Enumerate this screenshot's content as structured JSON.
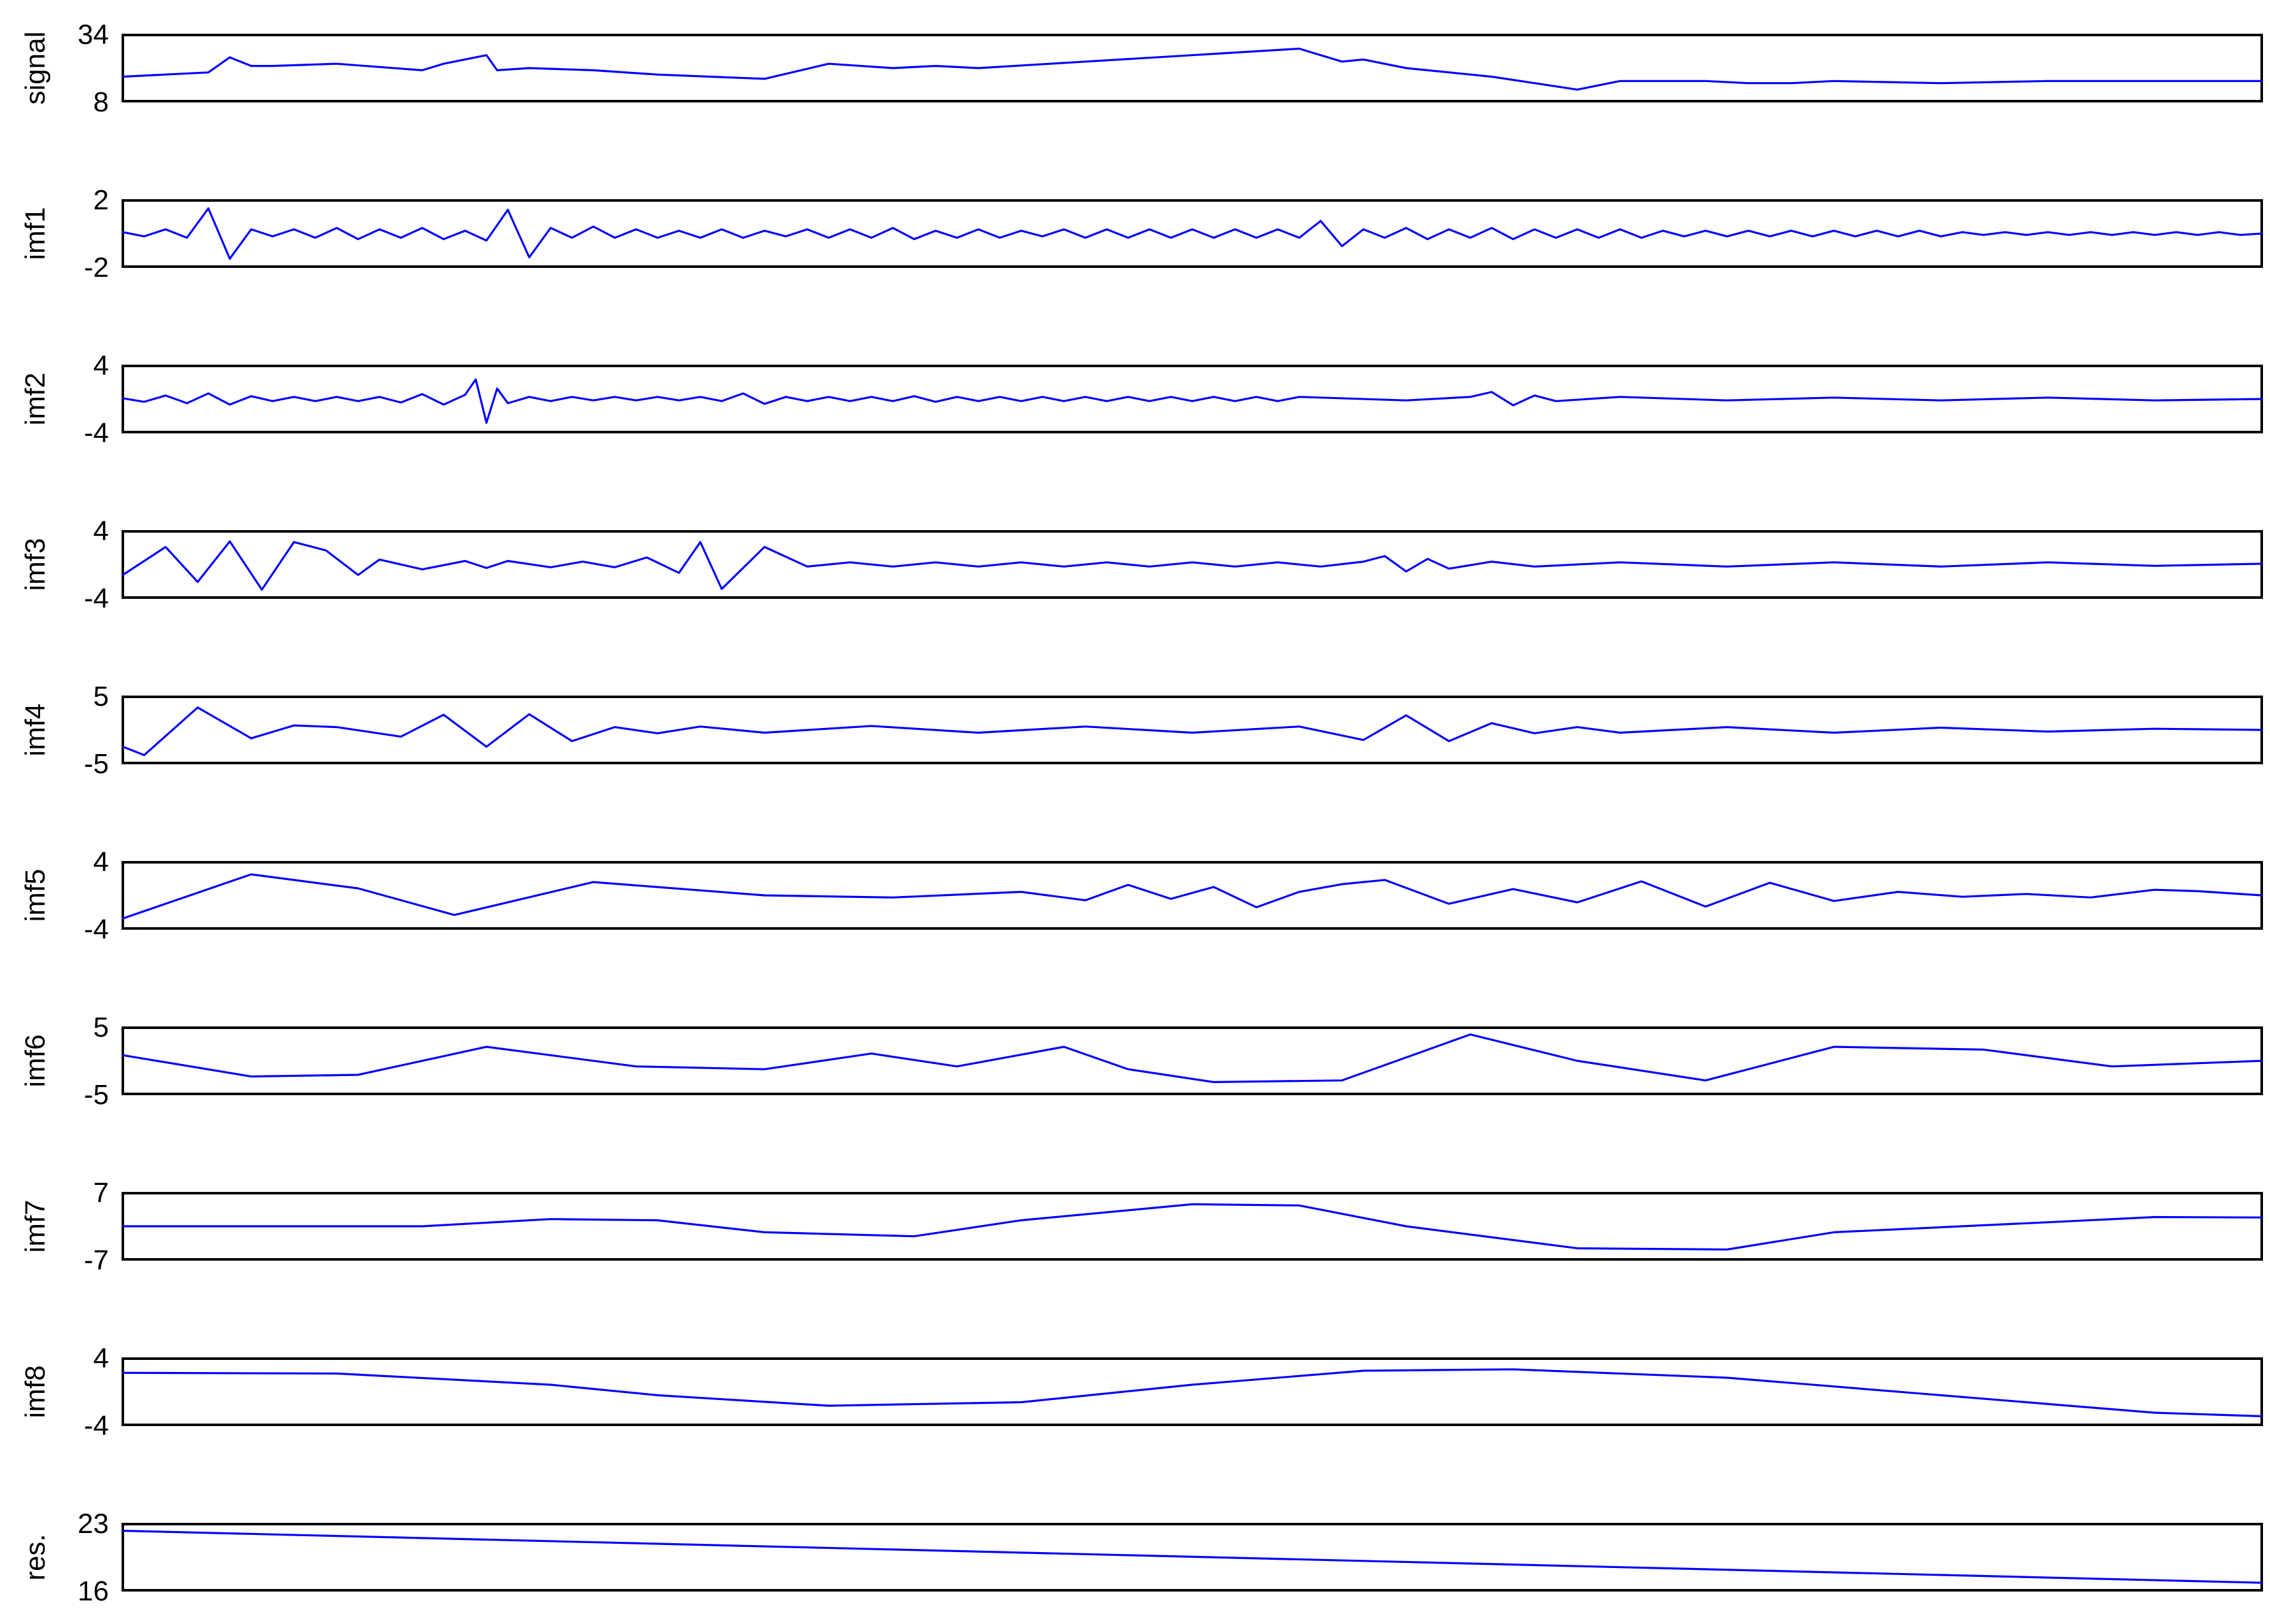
{
  "colors": {
    "trace": "#0000ff",
    "axes": "#000000",
    "background": "#ffffff"
  },
  "chart_data": [
    {
      "type": "line",
      "ylabel": "signal",
      "ylim": [
        8,
        34
      ],
      "yticks": [
        "34",
        "8"
      ],
      "grid": false,
      "legend": "none",
      "x": [
        0,
        0.04,
        0.05,
        0.06,
        0.07,
        0.1,
        0.14,
        0.15,
        0.17,
        0.175,
        0.19,
        0.22,
        0.25,
        0.3,
        0.33,
        0.36,
        0.38,
        0.4,
        0.45,
        0.5,
        0.55,
        0.57,
        0.58,
        0.6,
        0.64,
        0.68,
        0.7,
        0.72,
        0.74,
        0.76,
        0.78,
        0.8,
        0.85,
        0.9,
        0.95,
        1.0
      ],
      "y": [
        17,
        19,
        26,
        22,
        22,
        23,
        20,
        23,
        27,
        20,
        21,
        20,
        18,
        16,
        23,
        21,
        22,
        21,
        24,
        27,
        30,
        24,
        25,
        21,
        17,
        11,
        15,
        15,
        15,
        14,
        14,
        15,
        14,
        15,
        15,
        15
      ]
    },
    {
      "type": "line",
      "ylabel": "imf1",
      "ylim": [
        -2,
        2
      ],
      "yticks": [
        "2",
        "-2"
      ],
      "grid": false,
      "legend": "none",
      "x": [
        0,
        0.01,
        0.02,
        0.03,
        0.04,
        0.05,
        0.06,
        0.07,
        0.08,
        0.09,
        0.1,
        0.11,
        0.12,
        0.13,
        0.14,
        0.15,
        0.16,
        0.17,
        0.18,
        0.19,
        0.2,
        0.21,
        0.22,
        0.23,
        0.24,
        0.25,
        0.26,
        0.27,
        0.28,
        0.29,
        0.3,
        0.31,
        0.32,
        0.33,
        0.34,
        0.35,
        0.36,
        0.37,
        0.38,
        0.39,
        0.4,
        0.41,
        0.42,
        0.43,
        0.44,
        0.45,
        0.46,
        0.47,
        0.48,
        0.49,
        0.5,
        0.51,
        0.52,
        0.53,
        0.54,
        0.55,
        0.56,
        0.57,
        0.58,
        0.59,
        0.6,
        0.61,
        0.62,
        0.63,
        0.64,
        0.65,
        0.66,
        0.67,
        0.68,
        0.69,
        0.7,
        0.71,
        0.72,
        0.73,
        0.74,
        0.75,
        0.76,
        0.77,
        0.78,
        0.79,
        0.8,
        0.81,
        0.82,
        0.83,
        0.84,
        0.85,
        0.86,
        0.87,
        0.88,
        0.89,
        0.9,
        0.91,
        0.92,
        0.93,
        0.94,
        0.95,
        0.96,
        0.97,
        0.98,
        0.99,
        1.0
      ],
      "y": [
        0.1,
        -0.2,
        0.3,
        -0.3,
        1.8,
        -1.8,
        0.3,
        -0.2,
        0.3,
        -0.3,
        0.4,
        -0.4,
        0.3,
        -0.3,
        0.4,
        -0.4,
        0.2,
        -0.5,
        1.7,
        -1.7,
        0.4,
        -0.3,
        0.5,
        -0.3,
        0.3,
        -0.3,
        0.2,
        -0.3,
        0.3,
        -0.3,
        0.2,
        -0.2,
        0.3,
        -0.3,
        0.3,
        -0.3,
        0.4,
        -0.4,
        0.2,
        -0.3,
        0.3,
        -0.3,
        0.2,
        -0.2,
        0.3,
        -0.3,
        0.3,
        -0.3,
        0.3,
        -0.3,
        0.3,
        -0.3,
        0.3,
        -0.3,
        0.3,
        -0.3,
        0.9,
        -0.9,
        0.3,
        -0.3,
        0.4,
        -0.4,
        0.3,
        -0.3,
        0.4,
        -0.4,
        0.3,
        -0.3,
        0.3,
        -0.3,
        0.3,
        -0.3,
        0.2,
        -0.2,
        0.2,
        -0.2,
        0.2,
        -0.2,
        0.2,
        -0.2,
        0.2,
        -0.2,
        0.2,
        -0.2,
        0.2,
        -0.2,
        0.1,
        -0.1,
        0.1,
        -0.1,
        0.1,
        -0.1,
        0.1,
        -0.1,
        0.1,
        -0.1,
        0.1,
        -0.1,
        0.1,
        -0.1,
        0
      ]
    },
    {
      "type": "line",
      "ylabel": "imf2",
      "ylim": [
        -4,
        4
      ],
      "yticks": [
        "4",
        "-4"
      ],
      "grid": false,
      "legend": "none",
      "x": [
        0,
        0.01,
        0.02,
        0.03,
        0.04,
        0.05,
        0.06,
        0.07,
        0.08,
        0.09,
        0.1,
        0.11,
        0.12,
        0.13,
        0.14,
        0.15,
        0.16,
        0.165,
        0.17,
        0.175,
        0.18,
        0.19,
        0.2,
        0.21,
        0.22,
        0.23,
        0.24,
        0.25,
        0.26,
        0.27,
        0.28,
        0.29,
        0.3,
        0.31,
        0.32,
        0.33,
        0.34,
        0.35,
        0.36,
        0.37,
        0.38,
        0.39,
        0.4,
        0.41,
        0.42,
        0.43,
        0.44,
        0.45,
        0.46,
        0.47,
        0.48,
        0.49,
        0.5,
        0.51,
        0.52,
        0.53,
        0.54,
        0.55,
        0.6,
        0.63,
        0.64,
        0.65,
        0.66,
        0.67,
        0.7,
        0.75,
        0.8,
        0.85,
        0.9,
        0.95,
        1.0
      ],
      "y": [
        0.1,
        -0.4,
        0.5,
        -0.6,
        0.8,
        -0.8,
        0.4,
        -0.3,
        0.3,
        -0.3,
        0.3,
        -0.3,
        0.3,
        -0.5,
        0.7,
        -0.8,
        0.6,
        2.8,
        -3.4,
        1.5,
        -0.6,
        0.3,
        -0.3,
        0.3,
        -0.2,
        0.3,
        -0.2,
        0.3,
        -0.2,
        0.3,
        -0.3,
        0.8,
        -0.7,
        0.3,
        -0.3,
        0.3,
        -0.3,
        0.3,
        -0.3,
        0.4,
        -0.4,
        0.3,
        -0.3,
        0.3,
        -0.3,
        0.3,
        -0.3,
        0.3,
        -0.3,
        0.3,
        -0.3,
        0.3,
        -0.3,
        0.3,
        -0.3,
        0.3,
        -0.3,
        0.3,
        -0.2,
        0.3,
        1.0,
        -0.9,
        0.5,
        -0.3,
        0.3,
        -0.2,
        0.2,
        -0.2,
        0.2,
        -0.2,
        0
      ]
    },
    {
      "type": "line",
      "ylabel": "imf3",
      "ylim": [
        -4,
        4
      ],
      "yticks": [
        "4",
        "-4"
      ],
      "grid": false,
      "legend": "none",
      "x": [
        0,
        0.02,
        0.035,
        0.05,
        0.065,
        0.08,
        0.095,
        0.11,
        0.12,
        0.14,
        0.16,
        0.17,
        0.18,
        0.2,
        0.215,
        0.23,
        0.245,
        0.26,
        0.27,
        0.28,
        0.3,
        0.32,
        0.34,
        0.36,
        0.38,
        0.4,
        0.42,
        0.44,
        0.46,
        0.48,
        0.5,
        0.52,
        0.54,
        0.56,
        0.58,
        0.59,
        0.6,
        0.61,
        0.62,
        0.64,
        0.66,
        0.7,
        0.75,
        0.8,
        0.85,
        0.9,
        0.95,
        1.0
      ],
      "y": [
        -1.5,
        2.5,
        -2.5,
        3.3,
        -3.6,
        3.2,
        2.0,
        -1.5,
        0.7,
        -0.7,
        0.5,
        -0.5,
        0.5,
        -0.4,
        0.4,
        -0.4,
        1.0,
        -1.2,
        3.2,
        -3.5,
        2.5,
        -0.3,
        0.3,
        -0.3,
        0.3,
        -0.3,
        0.3,
        -0.3,
        0.3,
        -0.3,
        0.3,
        -0.3,
        0.3,
        -0.3,
        0.4,
        1.2,
        -1.0,
        0.8,
        -0.6,
        0.4,
        -0.3,
        0.3,
        -0.3,
        0.3,
        -0.3,
        0.3,
        -0.2,
        0.1
      ]
    },
    {
      "type": "line",
      "ylabel": "imf4",
      "ylim": [
        -5,
        5
      ],
      "yticks": [
        "5",
        "-5"
      ],
      "grid": false,
      "legend": "none",
      "x": [
        0,
        0.01,
        0.035,
        0.06,
        0.08,
        0.1,
        0.13,
        0.15,
        0.17,
        0.19,
        0.21,
        0.23,
        0.25,
        0.27,
        0.3,
        0.35,
        0.4,
        0.45,
        0.5,
        0.55,
        0.58,
        0.6,
        0.62,
        0.64,
        0.66,
        0.68,
        0.7,
        0.75,
        0.8,
        0.85,
        0.9,
        0.95,
        1.0
      ],
      "y": [
        -3,
        -4.5,
        4.0,
        -1.5,
        0.8,
        0.5,
        -1.2,
        2.7,
        -3.0,
        2.8,
        -2.0,
        0.5,
        -0.6,
        0.6,
        -0.5,
        0.7,
        -0.5,
        0.6,
        -0.5,
        0.6,
        -1.8,
        2.6,
        -2.0,
        1.2,
        -0.6,
        0.5,
        -0.5,
        0.5,
        -0.5,
        0.4,
        -0.3,
        0.2,
        0
      ]
    },
    {
      "type": "line",
      "ylabel": "imf5",
      "ylim": [
        -4,
        4
      ],
      "yticks": [
        "4",
        "-4"
      ],
      "grid": false,
      "legend": "none",
      "x": [
        0,
        0.06,
        0.11,
        0.155,
        0.22,
        0.3,
        0.36,
        0.42,
        0.45,
        0.47,
        0.49,
        0.51,
        0.53,
        0.55,
        0.57,
        0.59,
        0.62,
        0.65,
        0.68,
        0.71,
        0.74,
        0.77,
        0.8,
        0.83,
        0.86,
        0.89,
        0.92,
        0.95,
        0.97,
        1.0
      ],
      "y": [
        -3.3,
        3.0,
        1.0,
        -2.8,
        1.9,
        0,
        -0.3,
        0.5,
        -0.7,
        1.5,
        -0.5,
        1.2,
        -1.7,
        0.5,
        1.6,
        2.2,
        -1.2,
        0.9,
        -1.0,
        2.0,
        -1.6,
        1.8,
        -0.8,
        0.5,
        -0.2,
        0.2,
        -0.3,
        0.8,
        0.6,
        0
      ]
    },
    {
      "type": "line",
      "ylabel": "imf6",
      "ylim": [
        -5,
        5
      ],
      "yticks": [
        "5",
        "-5"
      ],
      "grid": false,
      "legend": "none",
      "x": [
        0,
        0.06,
        0.11,
        0.17,
        0.24,
        0.3,
        0.35,
        0.39,
        0.44,
        0.47,
        0.51,
        0.57,
        0.63,
        0.68,
        0.74,
        0.8,
        0.87,
        0.93,
        1.0
      ],
      "y": [
        1,
        -2.8,
        -2.5,
        2.5,
        -1.0,
        -1.5,
        1.3,
        -1.0,
        2.5,
        -1.5,
        -3.8,
        -3.5,
        4.7,
        0,
        -3.5,
        2.5,
        2.0,
        -1.0,
        0
      ]
    },
    {
      "type": "line",
      "ylabel": "imf7",
      "ylim": [
        -7,
        7
      ],
      "yticks": [
        "7",
        "-7"
      ],
      "grid": false,
      "legend": "none",
      "x": [
        0,
        0.06,
        0.14,
        0.2,
        0.25,
        0.3,
        0.37,
        0.42,
        0.5,
        0.55,
        0.6,
        0.68,
        0.75,
        0.8,
        0.9,
        0.95,
        1.0
      ],
      "y": [
        0,
        0,
        0,
        1.8,
        1.5,
        -1.5,
        -2.5,
        1.5,
        5.5,
        5.2,
        0,
        -5.5,
        -5.8,
        -1.5,
        1.0,
        2.3,
        2.2
      ]
    },
    {
      "type": "line",
      "ylabel": "imf8",
      "ylim": [
        -4,
        4
      ],
      "yticks": [
        "4",
        "-4"
      ],
      "grid": false,
      "legend": "none",
      "x": [
        0,
        0.1,
        0.2,
        0.25,
        0.33,
        0.42,
        0.5,
        0.58,
        0.65,
        0.75,
        0.85,
        0.95,
        1.0
      ],
      "y": [
        2.7,
        2.6,
        1.0,
        -0.5,
        -2.0,
        -1.5,
        1.0,
        3.0,
        3.2,
        2.0,
        -0.5,
        -3.0,
        -3.5
      ]
    },
    {
      "type": "line",
      "ylabel": "res.",
      "ylim": [
        16,
        23
      ],
      "yticks": [
        "23",
        "16"
      ],
      "grid": false,
      "legend": "none",
      "x": [
        0,
        1.0
      ],
      "y": [
        22.8,
        16.3
      ]
    }
  ]
}
